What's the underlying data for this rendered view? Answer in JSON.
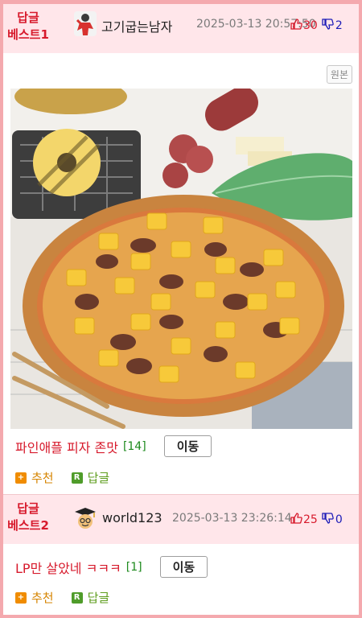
{
  "posts": [
    {
      "best_label_line1": "답글",
      "best_label_line2": "베스트1",
      "author": "고기굽는남자",
      "date": "2025-03-13 20:57:50",
      "up_count": "30",
      "down_count": "2",
      "original_label": "원본",
      "title": "파인애플 피자 존맛",
      "comment_count": "[14]",
      "move_label": "이동",
      "recommend_label": "추천",
      "reply_label": "답글"
    },
    {
      "best_label_line1": "답글",
      "best_label_line2": "베스트2",
      "author": "world123",
      "date": "2025-03-13 23:26:14",
      "up_count": "25",
      "down_count": "0",
      "title": "LP만 살았네 ㅋㅋㅋ",
      "comment_count": "[1]",
      "move_label": "이동",
      "recommend_label": "추천",
      "reply_label": "답글"
    }
  ],
  "icons": {
    "thumb_up": "thumb-up-icon",
    "thumb_down": "thumb-down-icon",
    "recommend": "plus-square-icon",
    "reply": "r-square-icon"
  },
  "icon_glyphs": {
    "plus": "+",
    "r": "R"
  },
  "colors": {
    "accent_red": "#d71a2c",
    "down_blue": "#1c1cb8",
    "comment_green": "#1d8a1d",
    "header_bg": "#ffe6ea",
    "border_pink": "#f4a9ae"
  }
}
